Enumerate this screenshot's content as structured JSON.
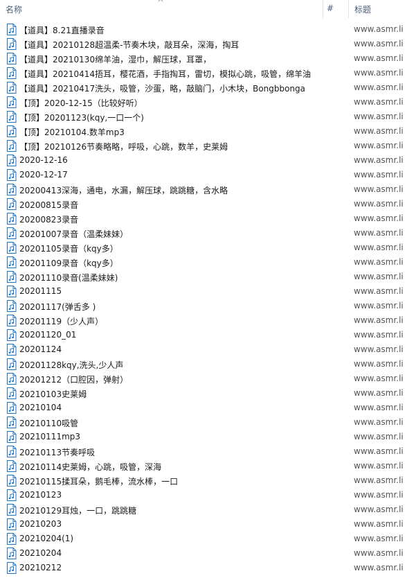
{
  "columns": {
    "name": "名称",
    "number": "#",
    "title": "标题"
  },
  "files": [
    {
      "name": "【道具】8.21直播录音",
      "title": "www.asmr.li"
    },
    {
      "name": "【道具】20210128超温柔-节奏木块，敲耳朵，深海，掏耳",
      "title": "www.asmr.li"
    },
    {
      "name": "【道具】20210130绵羊油，湿巾，解压球，耳罩，",
      "title": "www.asmr.li"
    },
    {
      "name": "【道具】20210414捂耳，樱花酒，手指掏耳，雷切，模拟心跳，吸管，绵羊油",
      "title": "www.asmr.li"
    },
    {
      "name": "【道具】20210417洗头，吸管，沙蛋，略，敲脑门，小木块，Bongbbonga",
      "title": "www.asmr.li"
    },
    {
      "name": "【顶】2020-12-15（比较好听）",
      "title": "www.asmr.li"
    },
    {
      "name": "【顶】20201123(kqy,一口一个)",
      "title": "www.asmr.li"
    },
    {
      "name": "【顶】20210104.数羊mp3",
      "title": "www.asmr.li"
    },
    {
      "name": "【顶】20210126节奏略略，呼吸，心跳，数羊，史莱姆",
      "title": "www.asmr.li"
    },
    {
      "name": "2020-12-16",
      "title": "www.asmr.li"
    },
    {
      "name": "2020-12-17",
      "title": "www.asmr.li"
    },
    {
      "name": "20200413深海，通电，水漏，解压球，跳跳糖，含水略",
      "title": "www.asmr.li"
    },
    {
      "name": "20200815录音",
      "title": "www.asmr.li"
    },
    {
      "name": "20200823录音",
      "title": "www.asmr.li"
    },
    {
      "name": "20201007录音（温柔妹妹）",
      "title": "www.asmr.li"
    },
    {
      "name": "20201105录音（kqy多）",
      "title": "www.asmr.li"
    },
    {
      "name": "20201109录音（kqy多）",
      "title": "www.asmr.li"
    },
    {
      "name": "20201110录音(温柔妹妹)",
      "title": "www.asmr.li"
    },
    {
      "name": "20201115",
      "title": "www.asmr.li"
    },
    {
      "name": "20201117(弹舌多 )",
      "title": "www.asmr.li"
    },
    {
      "name": "20201119（少人声）",
      "title": "www.asmr.li"
    },
    {
      "name": "20201120_01",
      "title": "www.asmr.li"
    },
    {
      "name": "20201124",
      "title": "www.asmr.li"
    },
    {
      "name": "20201128kqy,洗头,少人声",
      "title": "www.asmr.li"
    },
    {
      "name": "20201212（口腔因，弹射）",
      "title": "www.asmr.li"
    },
    {
      "name": "20210103史莱姆",
      "title": "www.asmr.li"
    },
    {
      "name": "20210104",
      "title": "www.asmr.li"
    },
    {
      "name": "20210110吸管",
      "title": "www.asmr.li"
    },
    {
      "name": "20210111mp3",
      "title": "www.asmr.li"
    },
    {
      "name": "20210113节奏呼吸",
      "title": "www.asmr.li"
    },
    {
      "name": "20210114史莱姆，心跳，吸管，深海",
      "title": "www.asmr.li"
    },
    {
      "name": "20210115揉耳朵，鹅毛棒，流水棒，一口",
      "title": "www.asmr.li"
    },
    {
      "name": "20210123",
      "title": "www.asmr.li"
    },
    {
      "name": "20210129耳烛，一口，跳跳糖",
      "title": "www.asmr.li"
    },
    {
      "name": "20210203",
      "title": "www.asmr.li"
    },
    {
      "name": "20210204(1)",
      "title": "www.asmr.li"
    },
    {
      "name": "20210204",
      "title": "www.asmr.li"
    },
    {
      "name": "20210212",
      "title": "www.asmr.li"
    }
  ],
  "icon": "audio-file-icon",
  "colors": {
    "header_text": "#4c607a",
    "icon_accent": "#1a73c9",
    "title_text": "#555555"
  }
}
